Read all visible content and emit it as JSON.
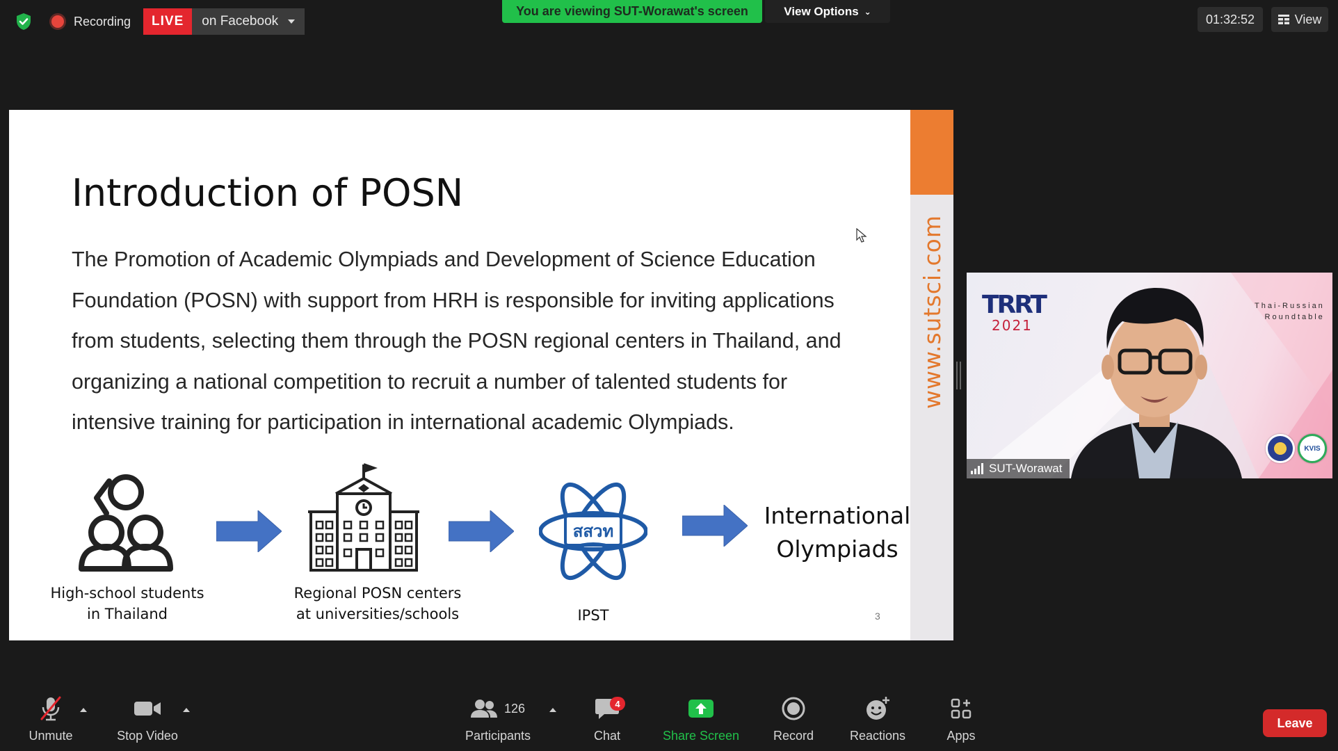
{
  "top_bar": {
    "recording_label": "Recording",
    "live_badge": "LIVE",
    "live_destination": "on Facebook",
    "viewing_banner": "You are viewing SUT-Worawat's screen",
    "view_options_label": "View Options",
    "meeting_timer": "01:32:52",
    "view_label": "View"
  },
  "slide": {
    "title": "Introduction of POSN",
    "body_lines": [
      "The Promotion of Academic Olympiads and Development of Science Education",
      "Foundation (POSN) with support from HRH is responsible for inviting applications",
      "from students, selecting them through the POSN regional centers in Thailand, and",
      "organizing a national competition to recruit a number of talented students for",
      "intensive training for participation in international academic Olympiads."
    ],
    "website": "www.sutsci.com",
    "flow": {
      "step1": [
        "High-school students",
        "in Thailand"
      ],
      "step2": [
        "Regional POSN centers",
        "at universities/schools"
      ],
      "step3_logo_text": "สสวท",
      "step3": "IPST",
      "step4": [
        "International",
        "Olympiads"
      ]
    },
    "page_number": "3",
    "accent_color": "#ec7d31",
    "arrow_color": "#4472c4"
  },
  "video_tile": {
    "participant_name": "SUT-Worawat",
    "logo_text": "TRRT",
    "logo_year": "2021",
    "roundtable_text": [
      "Thai-Russian",
      "Roundtable"
    ],
    "emblem2_text": "KVIS"
  },
  "toolbar": {
    "unmute": "Unmute",
    "stop_video": "Stop Video",
    "participants": "Participants",
    "participant_count": "126",
    "chat": "Chat",
    "chat_badge": "4",
    "share_screen": "Share Screen",
    "record": "Record",
    "reactions": "Reactions",
    "apps": "Apps",
    "leave": "Leave",
    "share_color": "#21c04a",
    "leave_color": "#d42a2a"
  }
}
